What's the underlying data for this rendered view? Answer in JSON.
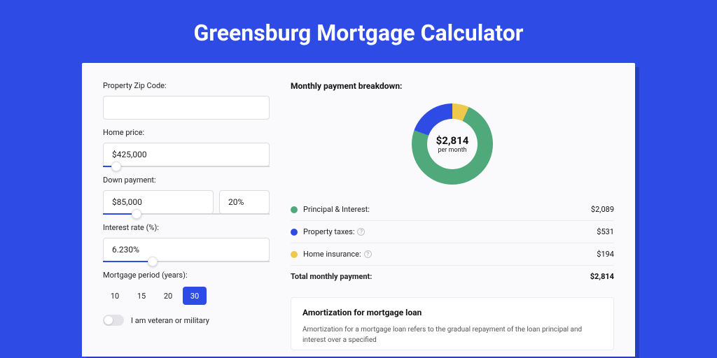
{
  "hero_title": "Greensburg Mortgage Calculator",
  "left": {
    "zip_label": "Property Zip Code:",
    "zip_value": "",
    "home_price_label": "Home price:",
    "home_price_value": "$425,000",
    "home_price_slider_pct": 8,
    "down_payment_label": "Down payment:",
    "down_payment_value": "$85,000",
    "down_payment_pct_value": "20%",
    "down_payment_slider_pct": 20,
    "interest_label": "Interest rate (%):",
    "interest_value": "6.230%",
    "interest_slider_pct": 30,
    "period_label": "Mortgage period (years):",
    "period_options": [
      "10",
      "15",
      "20",
      "30"
    ],
    "period_selected": "30",
    "veteran_label": "I am veteran or military"
  },
  "right": {
    "breakdown_title": "Monthly payment breakdown:",
    "center_value": "$2,814",
    "center_sub": "per month",
    "items": [
      {
        "label": "Principal & Interest:",
        "amount": "$2,089",
        "color": "green",
        "help": false
      },
      {
        "label": "Property taxes:",
        "amount": "$531",
        "color": "blue",
        "help": true
      },
      {
        "label": "Home insurance:",
        "amount": "$194",
        "color": "yellow",
        "help": true
      }
    ],
    "total_label": "Total monthly payment:",
    "total_amount": "$2,814",
    "amort_title": "Amortization for mortgage loan",
    "amort_body": "Amortization for a mortgage loan refers to the gradual repayment of the loan principal and interest over a specified"
  },
  "chart_data": {
    "type": "pie",
    "title": "Monthly payment breakdown",
    "series": [
      {
        "name": "Principal & Interest",
        "value": 2089,
        "color": "#4fa97a"
      },
      {
        "name": "Property taxes",
        "value": 531,
        "color": "#2e4ce5"
      },
      {
        "name": "Home insurance",
        "value": 194,
        "color": "#efc94c"
      }
    ],
    "total": 2814,
    "unit": "USD/month"
  }
}
